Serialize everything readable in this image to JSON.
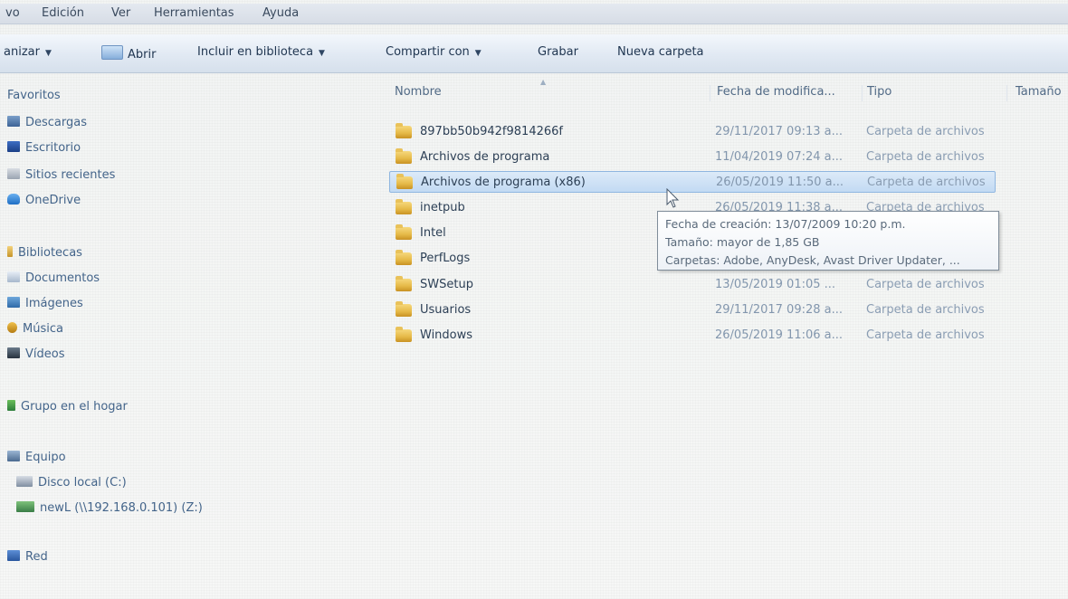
{
  "menu": [
    "vo",
    "Edición",
    "Ver",
    "Herramientas",
    "Ayuda"
  ],
  "toolbar": {
    "organize": "anizar",
    "open": "Abrir",
    "include": "Incluir en biblioteca",
    "share": "Compartir con",
    "burn": "Grabar",
    "new_folder": "Nueva carpeta"
  },
  "nav": {
    "favorites": "Favoritos",
    "downloads": "Descargas",
    "desktop": "Escritorio",
    "recent": "Sitios recientes",
    "onedrive": "OneDrive",
    "libraries": "Bibliotecas",
    "documents": "Documentos",
    "images": "Imágenes",
    "music": "Música",
    "videos": "Vídeos",
    "homegroup": "Grupo en el hogar",
    "computer": "Equipo",
    "local_disk": "Disco local (C:)",
    "network_drive": "newL (\\\\192.168.0.101) (Z:)",
    "network": "Red"
  },
  "columns": {
    "name": "Nombre",
    "date": "Fecha de modifica...",
    "type": "Tipo",
    "size": "Tamaño"
  },
  "files": [
    {
      "name": "897bb50b942f9814266f",
      "date": "29/11/2017 09:13 a...",
      "type": "Carpeta de archivos"
    },
    {
      "name": "Archivos de programa",
      "date": "11/04/2019 07:24 a...",
      "type": "Carpeta de archivos"
    },
    {
      "name": "Archivos de programa (x86)",
      "date": "26/05/2019 11:50 a...",
      "type": "Carpeta de archivos"
    },
    {
      "name": "inetpub",
      "date": "26/05/2019 11:38 a...",
      "type": "Carpeta de archivos"
    },
    {
      "name": "Intel",
      "date": "",
      "type": ""
    },
    {
      "name": "PerfLogs",
      "date": "",
      "type": ""
    },
    {
      "name": "SWSetup",
      "date": "13/05/2019 01:05 ...",
      "type": "Carpeta de archivos"
    },
    {
      "name": "Usuarios",
      "date": "29/11/2017 09:28 a...",
      "type": "Carpeta de archivos"
    },
    {
      "name": "Windows",
      "date": "26/05/2019 11:06 a...",
      "type": "Carpeta de archivos"
    }
  ],
  "tooltip": {
    "created": "Fecha de creación: 13/07/2009 10:20 p.m.",
    "size": "Tamaño: mayor de 1,85 GB",
    "folders": "Carpetas: Adobe, AnyDesk, Avast Driver Updater, ..."
  }
}
